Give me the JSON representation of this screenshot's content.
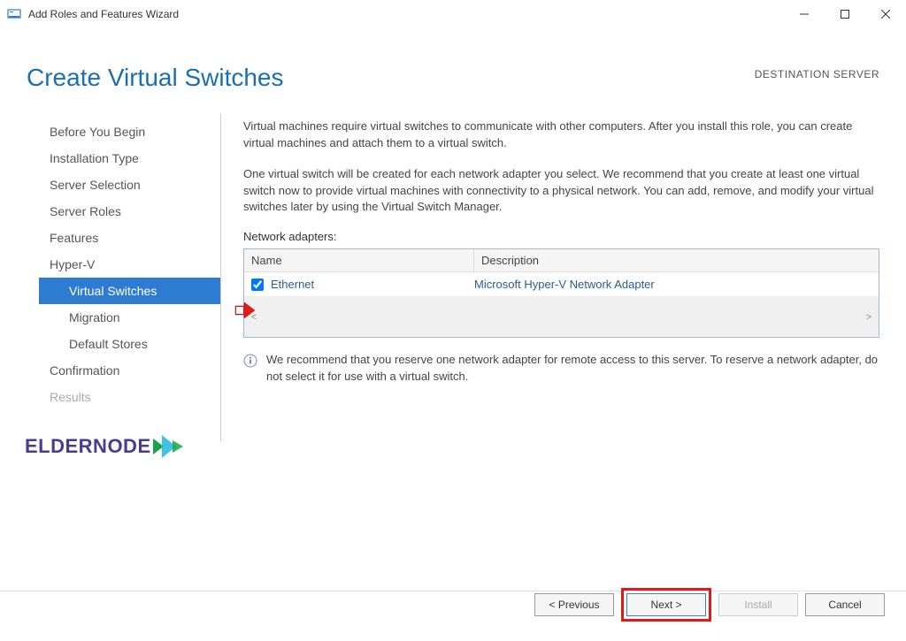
{
  "titlebar": {
    "title": "Add Roles and Features Wizard"
  },
  "header": {
    "pageTitle": "Create Virtual Switches",
    "destServer": "DESTINATION SERVER"
  },
  "sidebar": {
    "items": [
      {
        "label": "Before You Begin",
        "type": "top"
      },
      {
        "label": "Installation Type",
        "type": "top"
      },
      {
        "label": "Server Selection",
        "type": "top"
      },
      {
        "label": "Server Roles",
        "type": "top"
      },
      {
        "label": "Features",
        "type": "top"
      },
      {
        "label": "Hyper-V",
        "type": "top"
      },
      {
        "label": "Virtual Switches",
        "type": "sub",
        "selected": true
      },
      {
        "label": "Migration",
        "type": "sub"
      },
      {
        "label": "Default Stores",
        "type": "sub"
      },
      {
        "label": "Confirmation",
        "type": "top"
      },
      {
        "label": "Results",
        "type": "top",
        "disabled": true
      }
    ]
  },
  "content": {
    "para1": "Virtual machines require virtual switches to communicate with other computers. After you install this role, you can create virtual machines and attach them to a virtual switch.",
    "para2": "One virtual switch will be created for each network adapter you select. We recommend that you create at least one virtual switch now to provide virtual machines with connectivity to a physical network. You can add, remove, and modify your virtual switches later by using the Virtual Switch Manager.",
    "adaptersLabel": "Network adapters:",
    "columns": {
      "name": "Name",
      "description": "Description"
    },
    "rows": [
      {
        "checked": true,
        "name": "Ethernet",
        "description": "Microsoft Hyper-V Network Adapter"
      }
    ],
    "infoNote": "We recommend that you reserve one network adapter for remote access to this server. To reserve a network adapter, do not select it for use with a virtual switch."
  },
  "buttons": {
    "previous": "< Previous",
    "next": "Next >",
    "install": "Install",
    "cancel": "Cancel"
  },
  "logo": "ELDERNODE"
}
